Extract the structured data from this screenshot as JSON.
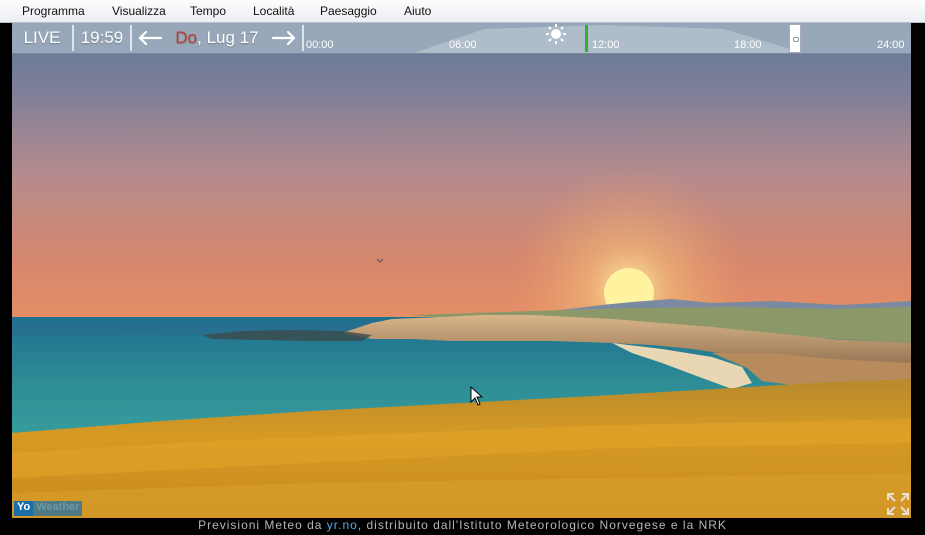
{
  "menu": {
    "items": [
      "Programma",
      "Visualizza",
      "Tempo",
      "Località",
      "Paesaggio",
      "Aiuto"
    ]
  },
  "toolbar": {
    "live_label": "LIVE",
    "time": "19:59",
    "date_day": "Do",
    "date_rest": ", Lug 17",
    "prev_icon": "arrow-left-icon",
    "next_icon": "arrow-right-icon"
  },
  "timeline": {
    "ticks": [
      "00:00",
      "06:00",
      "12:00",
      "18:00",
      "24:00"
    ],
    "current_time_fraction": 0.5,
    "sun_icon": "sun-icon",
    "slider_position_fraction": 0.83
  },
  "footer": {
    "text_before": "Previsioni Meteo da ",
    "link": "yr.no",
    "text_after": ", distribuito dall'Istituto Meteorologico Norvegese e la NRK"
  },
  "logo": {
    "part1": "Yo",
    "part2": "Weather"
  },
  "colors": {
    "accent_red": "#c0392b",
    "cursor_green": "#2ab52a",
    "link_blue": "#5aa9e8"
  }
}
